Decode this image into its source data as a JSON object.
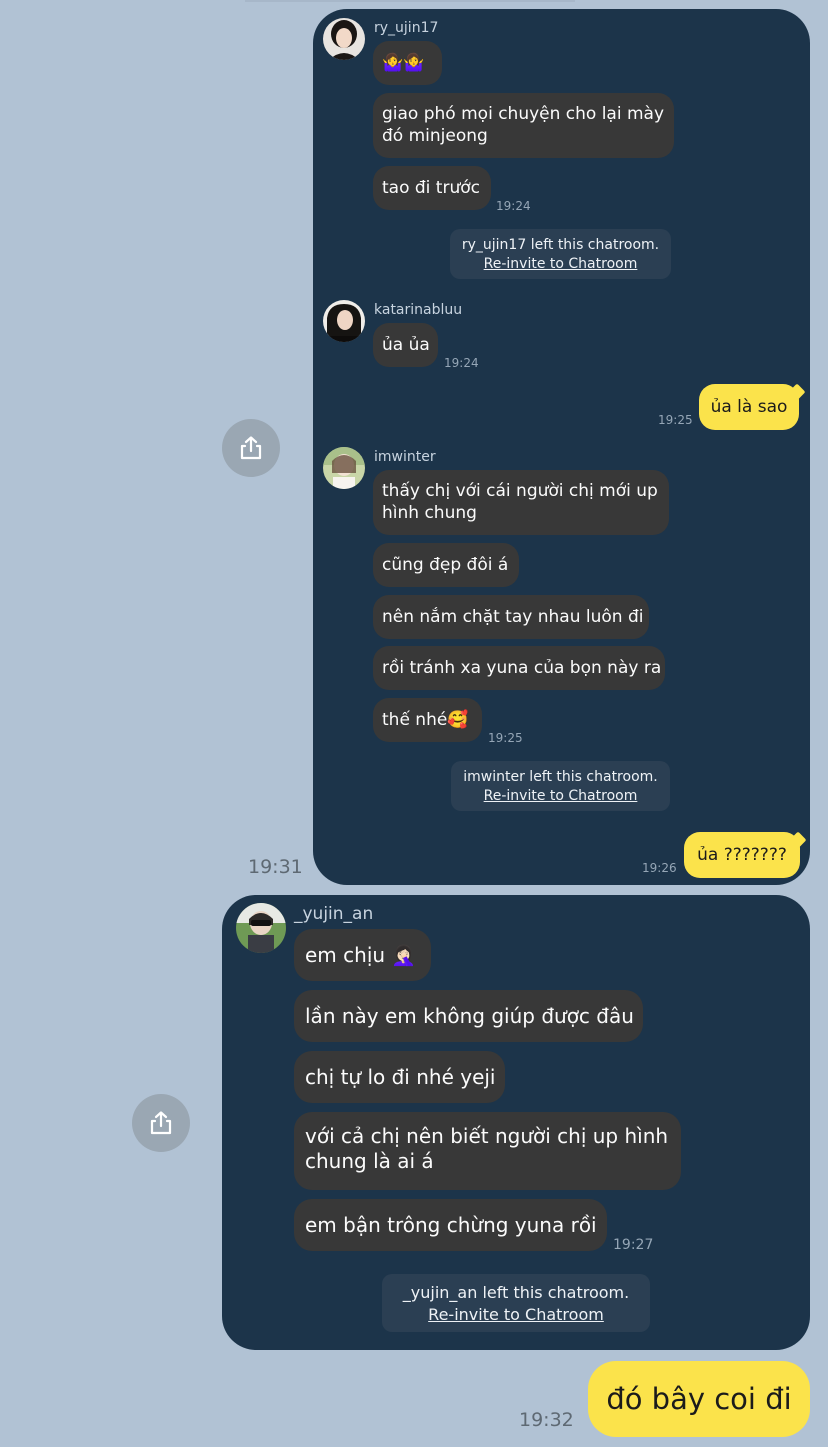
{
  "chat1": {
    "messages": [
      {
        "sender": "ry_ujin17",
        "bubbles": [
          "🤷‍♀️🤷‍♀️",
          "giao phó mọi chuyện cho lại mày đó minjeong",
          "tao đi trước"
        ],
        "time": "19:24"
      },
      {
        "system": "ry_ujin17 left this chatroom.",
        "link": "Re-invite to Chatroom"
      },
      {
        "sender": "katarinabluu",
        "bubbles": [
          "ủa ủa"
        ],
        "time": "19:24"
      },
      {
        "mine": "ủa là sao",
        "time": "19:25"
      },
      {
        "sender": "imwinter",
        "bubbles": [
          "thấy chị với cái người chị mới up hình chung",
          "cũng đẹp đôi á",
          "nên nắm chặt tay nhau luôn đi",
          "rồi tránh xa yuna của bọn này ra",
          "thế nhé🥰"
        ],
        "time": "19:25"
      },
      {
        "system": "imwinter left this chatroom.",
        "link": "Re-invite to Chatroom"
      },
      {
        "mine": "ủa ???????",
        "time": "19:26"
      }
    ],
    "outer_time": "19:31"
  },
  "chat2": {
    "sender": "_yujin_an",
    "bubbles": [
      "em chịu 🤦🏻‍♀️",
      "lần này em không giúp được đâu",
      "chị tự lo đi nhé yeji",
      "với cả chị nên biết người chị up hình chung là ai á",
      "em bận trông chừng yuna rồi"
    ],
    "time": "19:27",
    "system": "_yujin_an left this chatroom.",
    "link": "Re-invite to Chatroom"
  },
  "final": {
    "text": "đó bây coi đi",
    "time": "19:32"
  },
  "icons": {
    "share": "share-icon"
  },
  "colors": {
    "background": "#b1c2d4",
    "card": "#1c344a",
    "bubble": "#383838",
    "mine_bubble": "#fbe34b"
  }
}
